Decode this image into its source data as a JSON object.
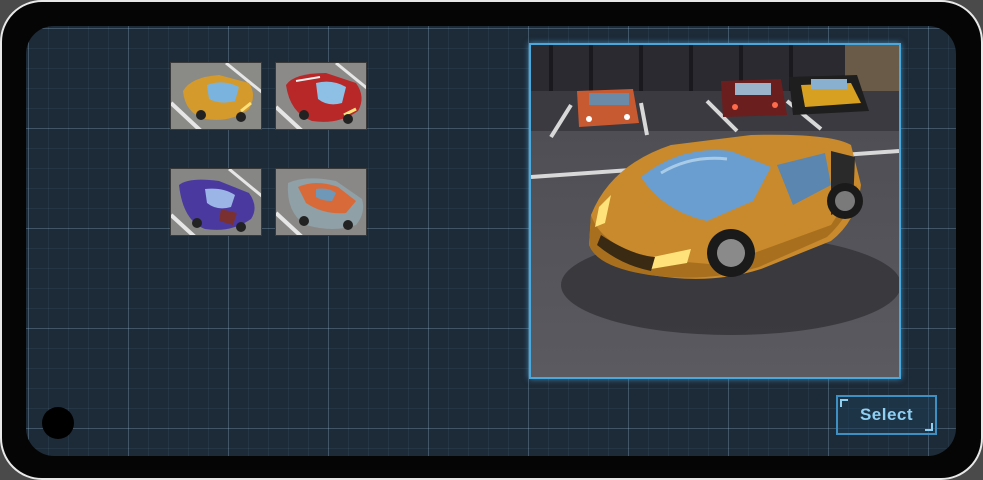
{
  "select_button": {
    "label": "Select"
  },
  "cars": [
    {
      "id": "car-1",
      "body": "#d49a2c",
      "icon": "orange-supercar-icon"
    },
    {
      "id": "car-2",
      "body": "#b82828",
      "icon": "red-sportscar-icon"
    },
    {
      "id": "car-3",
      "body": "#4a3aa0",
      "icon": "purple-car-icon"
    },
    {
      "id": "car-4",
      "body": "#d86a3a",
      "icon": "orange-muscle-car-icon"
    }
  ],
  "colors": {
    "accent": "#4aa8dc",
    "button_text": "#8fd0f2",
    "grid_background": "#1d2a37"
  }
}
